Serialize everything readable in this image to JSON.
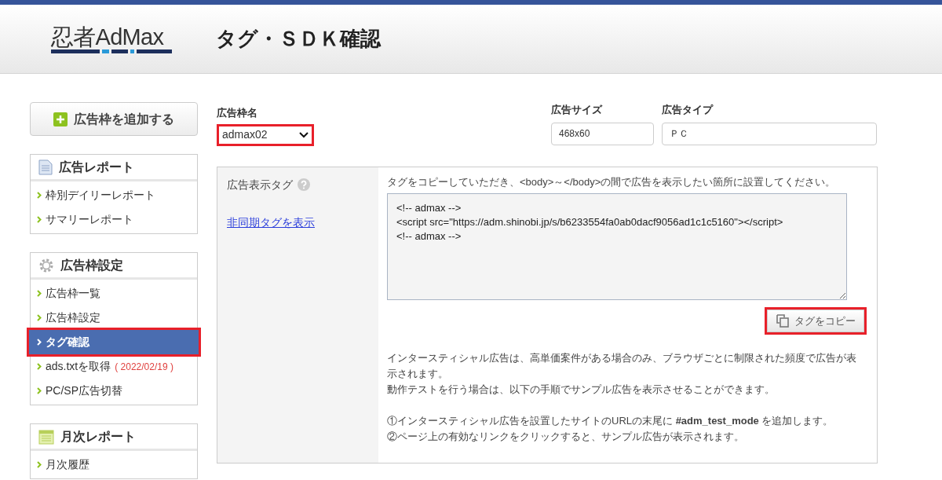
{
  "header": {
    "logo": "忍者AdMax",
    "title": "タグ・ＳＤＫ確認"
  },
  "add_button": {
    "label": "広告枠を追加する"
  },
  "sidebar": [
    {
      "title": "広告レポート",
      "items": [
        {
          "label": "枠別デイリーレポート",
          "selected": false
        },
        {
          "label": "サマリーレポート",
          "selected": false
        }
      ]
    },
    {
      "title": "広告枠設定",
      "items": [
        {
          "label": "広告枠一覧",
          "selected": false
        },
        {
          "label": "広告枠設定",
          "selected": false
        },
        {
          "label": "タグ確認",
          "selected": true,
          "highlighted": true
        },
        {
          "label": "ads.txtを取得",
          "note": "( 2022/02/19 )",
          "selected": false
        },
        {
          "label": "PC/SP広告切替",
          "selected": false
        }
      ]
    },
    {
      "title": "月次レポート",
      "items": [
        {
          "label": "月次履歴",
          "selected": false
        }
      ]
    }
  ],
  "form": {
    "ad_name": {
      "label": "広告枠名",
      "value": "admax02",
      "highlighted": true
    },
    "ad_size": {
      "label": "広告サイズ",
      "value": "468x60"
    },
    "ad_type": {
      "label": "広告タイプ",
      "value": "ＰＣ"
    }
  },
  "tag_panel": {
    "label": "広告表示タグ",
    "link": "非同期タグを表示",
    "instruction": "タグをコピーしていただき、<body>～</body>の間で広告を表示したい箇所に設置してください。",
    "code": [
      "<!-- admax -->",
      "<script src=\"https://adm.shinobi.jp/s/b6233554fa0ab0dacf9056ad1c1c5160\"></script>",
      "<!-- admax -->"
    ],
    "copy_button": {
      "label": "タグをコピー",
      "highlighted": true
    },
    "notes": [
      "インタースティシャル広告は、高単価案件がある場合のみ、ブラウザごとに制限された頻度で広告が表示されます。",
      "動作テストを行う場合は、以下の手順でサンプル広告を表示させることができます。"
    ],
    "steps": [
      "①インタースティシャル広告を設置したサイトのURLの末尾に **#adm_test_mode** を追加します。",
      "②ページ上の有効なリンクをクリックすると、サンプル広告が表示されます。"
    ]
  }
}
